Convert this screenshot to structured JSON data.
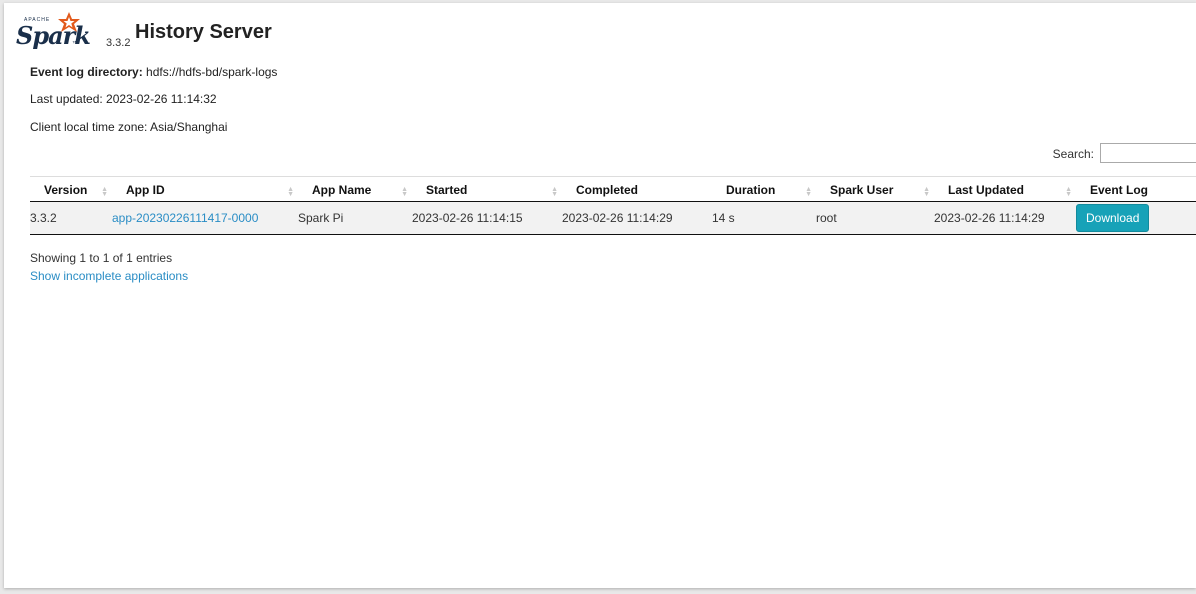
{
  "header": {
    "logo_apache": "APACHE",
    "logo_word": "Spark",
    "version": "3.3.2",
    "title": "History Server"
  },
  "info": {
    "event_log_label": "Event log directory:",
    "event_log_value": "hdfs://hdfs-bd/spark-logs",
    "last_updated": "Last updated: 2023-02-26 11:14:32",
    "time_zone": "Client local time zone: Asia/Shanghai"
  },
  "search": {
    "label": "Search:",
    "value": ""
  },
  "table": {
    "columns": [
      "Version",
      "App ID",
      "App Name",
      "Started",
      "Completed",
      "Duration",
      "Spark User",
      "Last Updated",
      "Event Log"
    ],
    "rows": [
      {
        "version": "3.3.2",
        "app_id": "app-20230226111417-0000",
        "app_name": "Spark Pi",
        "started": "2023-02-26 11:14:15",
        "completed": "2023-02-26 11:14:29",
        "duration": "14 s",
        "spark_user": "root",
        "last_updated": "2023-02-26 11:14:29",
        "event_log": "Download"
      }
    ]
  },
  "footer": {
    "entries": "Showing 1 to 1 of 1 entries",
    "show_incomplete": "Show incomplete applications"
  },
  "colors": {
    "link": "#2a8dc5",
    "button": "#17a2b8",
    "logo": "#1a2f4a",
    "star": "#e25a1c"
  }
}
